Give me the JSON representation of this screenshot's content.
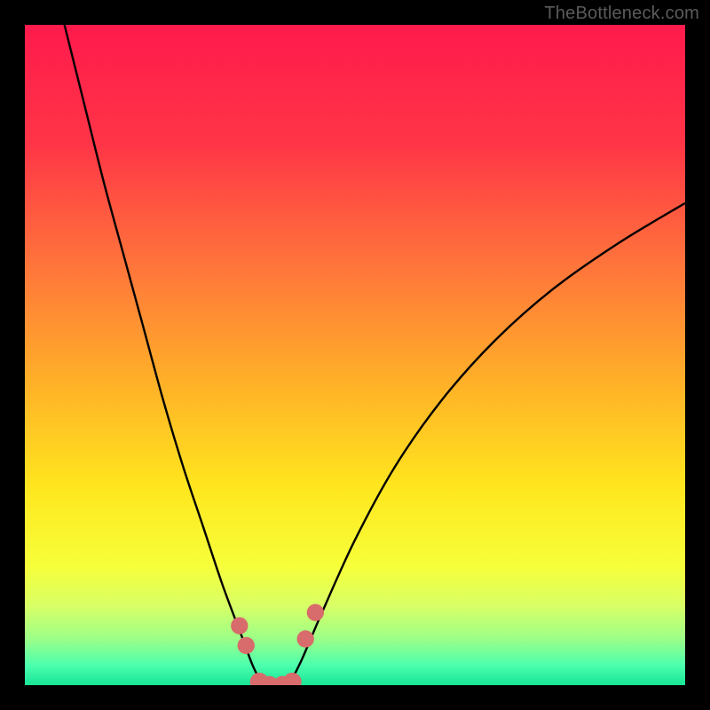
{
  "watermark": {
    "text": "TheBottleneck.com"
  },
  "chart_data": {
    "type": "line",
    "title": "",
    "xlabel": "",
    "ylabel": "",
    "xlim": [
      0,
      100
    ],
    "ylim": [
      0,
      100
    ],
    "grid": false,
    "legend": false,
    "series": [
      {
        "name": "left-curve",
        "x": [
          6,
          9,
          12,
          15,
          18,
          21,
          24,
          27,
          30,
          33,
          34.5,
          36
        ],
        "y": [
          100,
          88,
          76,
          65,
          54,
          43,
          33,
          24,
          15,
          7,
          3,
          0
        ]
      },
      {
        "name": "right-curve",
        "x": [
          40,
          42,
          45,
          50,
          56,
          63,
          71,
          80,
          90,
          100
        ],
        "y": [
          0,
          4,
          11,
          22,
          33,
          43,
          52,
          60,
          67,
          73
        ]
      },
      {
        "name": "valley-floor",
        "x": [
          36,
          37,
          38,
          39,
          40
        ],
        "y": [
          0,
          0,
          0,
          0,
          0
        ]
      }
    ],
    "markers": [
      {
        "name": "left-dot-1",
        "x": 32.5,
        "y": 9,
        "r": 1.3
      },
      {
        "name": "left-dot-2",
        "x": 33.5,
        "y": 6,
        "r": 1.3
      },
      {
        "name": "right-dot-1",
        "x": 42.5,
        "y": 7,
        "r": 1.3
      },
      {
        "name": "right-dot-2",
        "x": 44,
        "y": 11,
        "r": 1.3
      },
      {
        "name": "floor-dot-1",
        "x": 35.5,
        "y": 0.5,
        "r": 1.4
      },
      {
        "name": "floor-dot-2",
        "x": 37,
        "y": 0,
        "r": 1.4
      },
      {
        "name": "floor-dot-3",
        "x": 39,
        "y": 0,
        "r": 1.4
      },
      {
        "name": "floor-dot-4",
        "x": 40.5,
        "y": 0.5,
        "r": 1.4
      }
    ],
    "gradient_stops": [
      {
        "offset": 0,
        "color": "#ff1a4c"
      },
      {
        "offset": 0.18,
        "color": "#ff3547"
      },
      {
        "offset": 0.38,
        "color": "#ff7a3a"
      },
      {
        "offset": 0.55,
        "color": "#ffb327"
      },
      {
        "offset": 0.7,
        "color": "#ffe61e"
      },
      {
        "offset": 0.82,
        "color": "#f6ff3a"
      },
      {
        "offset": 0.88,
        "color": "#d8ff66"
      },
      {
        "offset": 0.93,
        "color": "#9cff88"
      },
      {
        "offset": 0.97,
        "color": "#4cffad"
      },
      {
        "offset": 1.0,
        "color": "#16e596"
      }
    ],
    "colors": {
      "curve_stroke": "#000000",
      "marker_fill": "#d86b6b",
      "valley_stroke": "#d86b6b"
    }
  }
}
